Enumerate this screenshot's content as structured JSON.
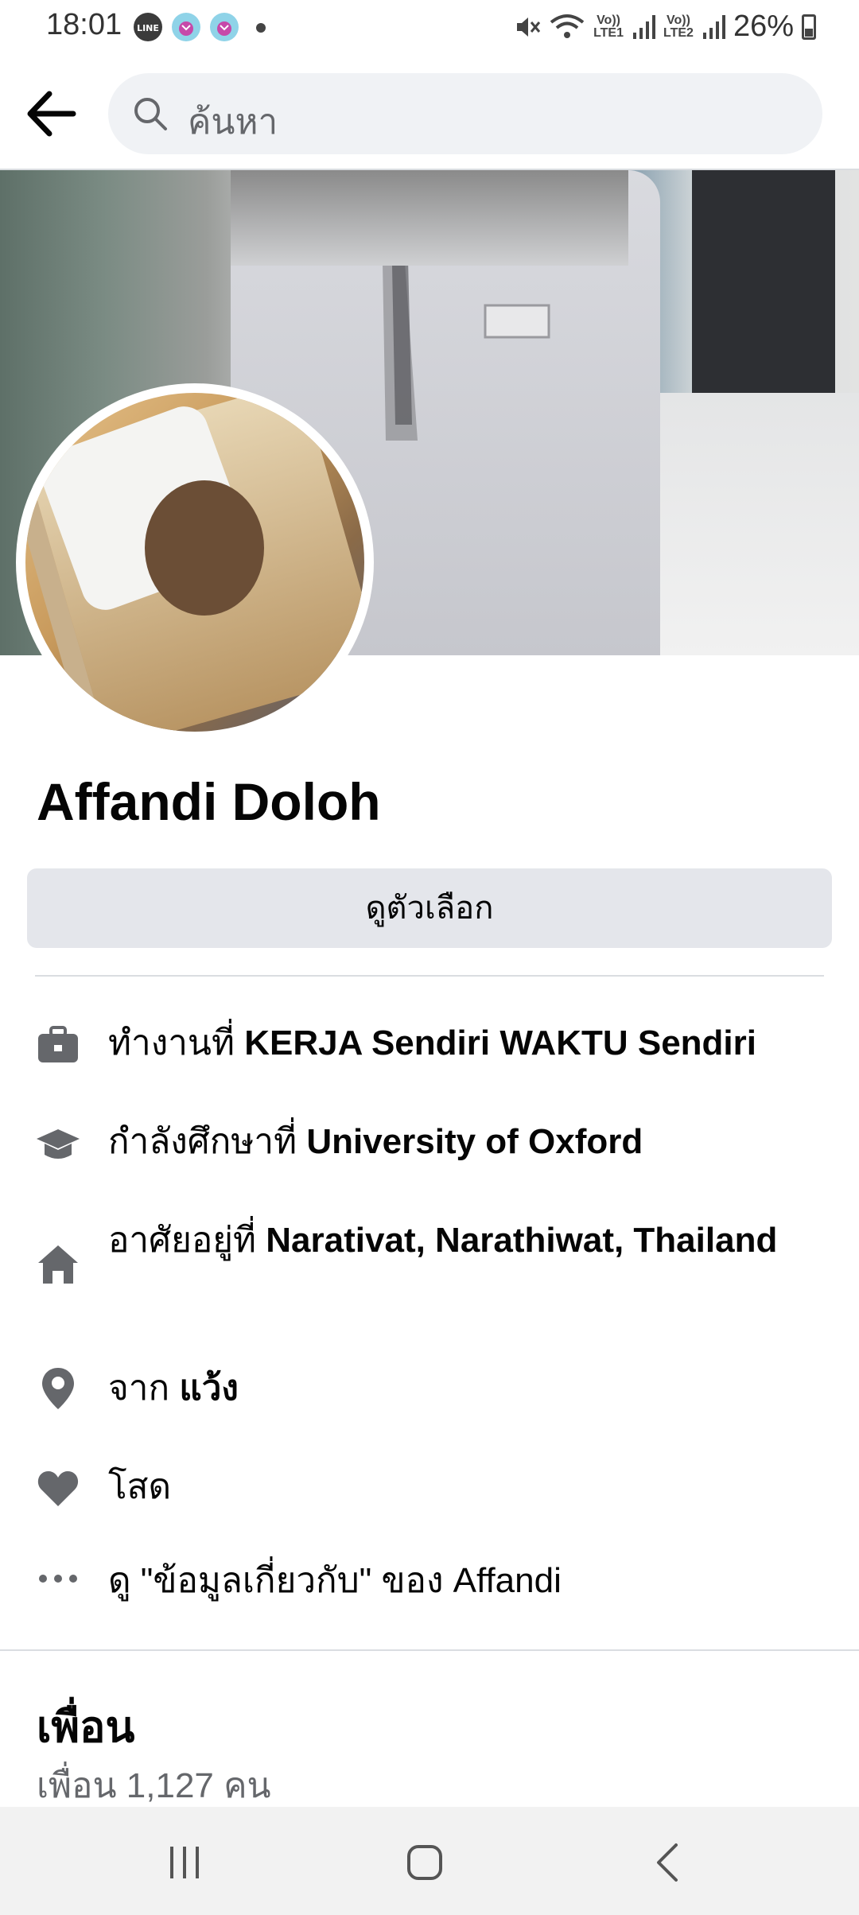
{
  "status_bar": {
    "time": "18:01",
    "notifications": [
      "line-icon",
      "app-notification-icon",
      "app-notification-icon"
    ],
    "lte1": "LTE1",
    "lte2": "LTE2",
    "volte": "Vo))",
    "battery": "26%"
  },
  "header": {
    "search_placeholder": "ค้นหา"
  },
  "profile": {
    "name": "Affandi Doloh",
    "options_label": "ดูตัวเลือก"
  },
  "details": [
    {
      "icon": "briefcase-icon",
      "prefix": "ทำงานที่ ",
      "value": "KERJA Sendiri WAKTU Sendiri"
    },
    {
      "icon": "graduation-cap-icon",
      "prefix": "กำลังศึกษาที่ ",
      "value": "University of Oxford"
    },
    {
      "icon": "home-icon",
      "prefix": "อาศัยอยู่ที่ ",
      "value": "Narativat, Narathiwat, Thailand"
    },
    {
      "icon": "location-pin-icon",
      "prefix": "จาก ",
      "value": "แว้ง"
    },
    {
      "icon": "heart-icon",
      "prefix": "โสด",
      "value": ""
    },
    {
      "icon": "more-dots-icon",
      "prefix": "ดู \"ข้อมูลเกี่ยวกับ\" ของ Affandi",
      "value": ""
    }
  ],
  "friends": {
    "title": "เพื่อน",
    "count": "เพื่อน 1,127 คน"
  },
  "colors": {
    "text": "#050505",
    "secondary": "#65676b",
    "button_bg": "#e4e6eb",
    "search_bg": "#f0f2f5"
  }
}
